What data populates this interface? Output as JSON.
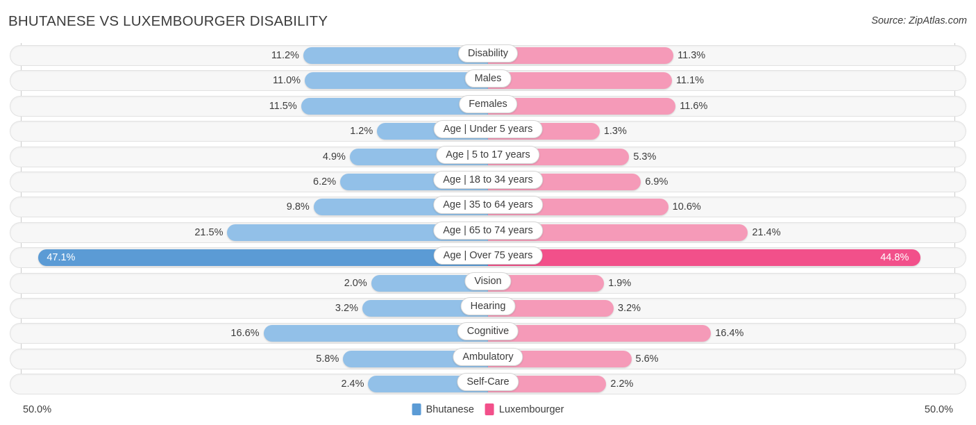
{
  "header": {
    "title": "BHUTANESE VS LUXEMBOURGER DISABILITY",
    "source": "Source: ZipAtlas.com"
  },
  "footer": {
    "axis_left": "50.0%",
    "axis_right": "50.0%",
    "legend": [
      {
        "label": "Bhutanese",
        "color": "#5b9bd5"
      },
      {
        "label": "Luxembourger",
        "color": "#f2508a"
      }
    ]
  },
  "colors": {
    "left_normal": "#92c0e8",
    "left_highlight": "#5b9bd5",
    "right_normal": "#f59ab8",
    "right_highlight": "#f2508a",
    "track": "#f7f7f7",
    "axis": "#c9c9c9",
    "text": "#3c3c3c"
  },
  "chart_data": {
    "type": "bar",
    "title": "BHUTANESE VS LUXEMBOURGER DISABILITY",
    "subtitle": "Source: ZipAtlas.com",
    "orientation": "horizontal-diverging",
    "xlabel": "",
    "ylabel": "",
    "xlim": [
      -50.0,
      50.0
    ],
    "axis_tick_labels": [
      "50.0%",
      "50.0%"
    ],
    "grid": false,
    "legend_position": "bottom-center",
    "categories": [
      "Disability",
      "Males",
      "Females",
      "Age | Under 5 years",
      "Age | 5 to 17 years",
      "Age | 18 to 34 years",
      "Age | 35 to 64 years",
      "Age | 65 to 74 years",
      "Age | Over 75 years",
      "Vision",
      "Hearing",
      "Cognitive",
      "Ambulatory",
      "Self-Care"
    ],
    "series": [
      {
        "name": "Bhutanese",
        "color": "#5b9bd5",
        "values": [
          11.2,
          11.0,
          11.5,
          1.2,
          4.9,
          6.2,
          9.8,
          21.5,
          47.1,
          2.0,
          3.2,
          16.6,
          5.8,
          2.4
        ],
        "labels": [
          "11.2%",
          "11.0%",
          "11.5%",
          "1.2%",
          "4.9%",
          "6.2%",
          "9.8%",
          "21.5%",
          "47.1%",
          "2.0%",
          "3.2%",
          "16.6%",
          "5.8%",
          "2.4%"
        ]
      },
      {
        "name": "Luxembourger",
        "color": "#f2508a",
        "values": [
          11.3,
          11.1,
          11.6,
          1.3,
          5.3,
          6.9,
          10.6,
          21.4,
          44.8,
          1.9,
          3.2,
          16.4,
          5.6,
          2.2
        ],
        "labels": [
          "11.3%",
          "11.1%",
          "11.6%",
          "1.3%",
          "5.3%",
          "6.9%",
          "10.6%",
          "21.4%",
          "44.8%",
          "1.9%",
          "3.2%",
          "16.4%",
          "5.6%",
          "2.2%"
        ]
      }
    ],
    "highlighted_rows": [
      "Age | Over 75 years"
    ]
  }
}
